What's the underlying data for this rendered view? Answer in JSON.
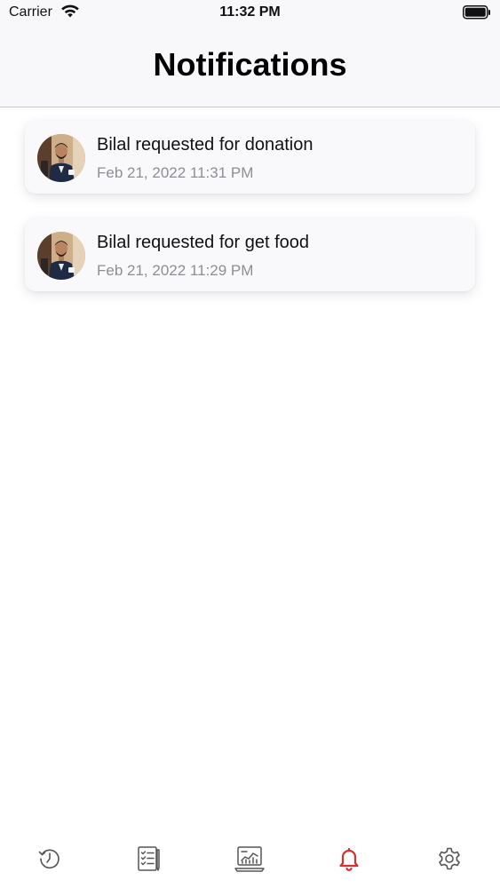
{
  "status_bar": {
    "carrier": "Carrier",
    "time": "11:32 PM",
    "wifi_icon": "wifi-icon",
    "battery_icon": "battery-icon"
  },
  "nav": {
    "title": "Notifications"
  },
  "notifications": [
    {
      "title": "Bilal requested for donation",
      "timestamp": "Feb 21, 2022 11:31 PM",
      "avatar": "user-avatar-photo"
    },
    {
      "title": "Bilal requested for get food",
      "timestamp": "Feb 21, 2022 11:29 PM",
      "avatar": "user-avatar-photo"
    }
  ],
  "tab_bar": {
    "tabs": [
      {
        "icon": "history-icon",
        "active": false
      },
      {
        "icon": "checklist-icon",
        "active": false
      },
      {
        "icon": "dashboard-chart-icon",
        "active": false
      },
      {
        "icon": "bell-icon",
        "active": true
      },
      {
        "icon": "gear-icon",
        "active": false
      }
    ],
    "active_color": "#d0342c",
    "inactive_color": "#555555"
  }
}
